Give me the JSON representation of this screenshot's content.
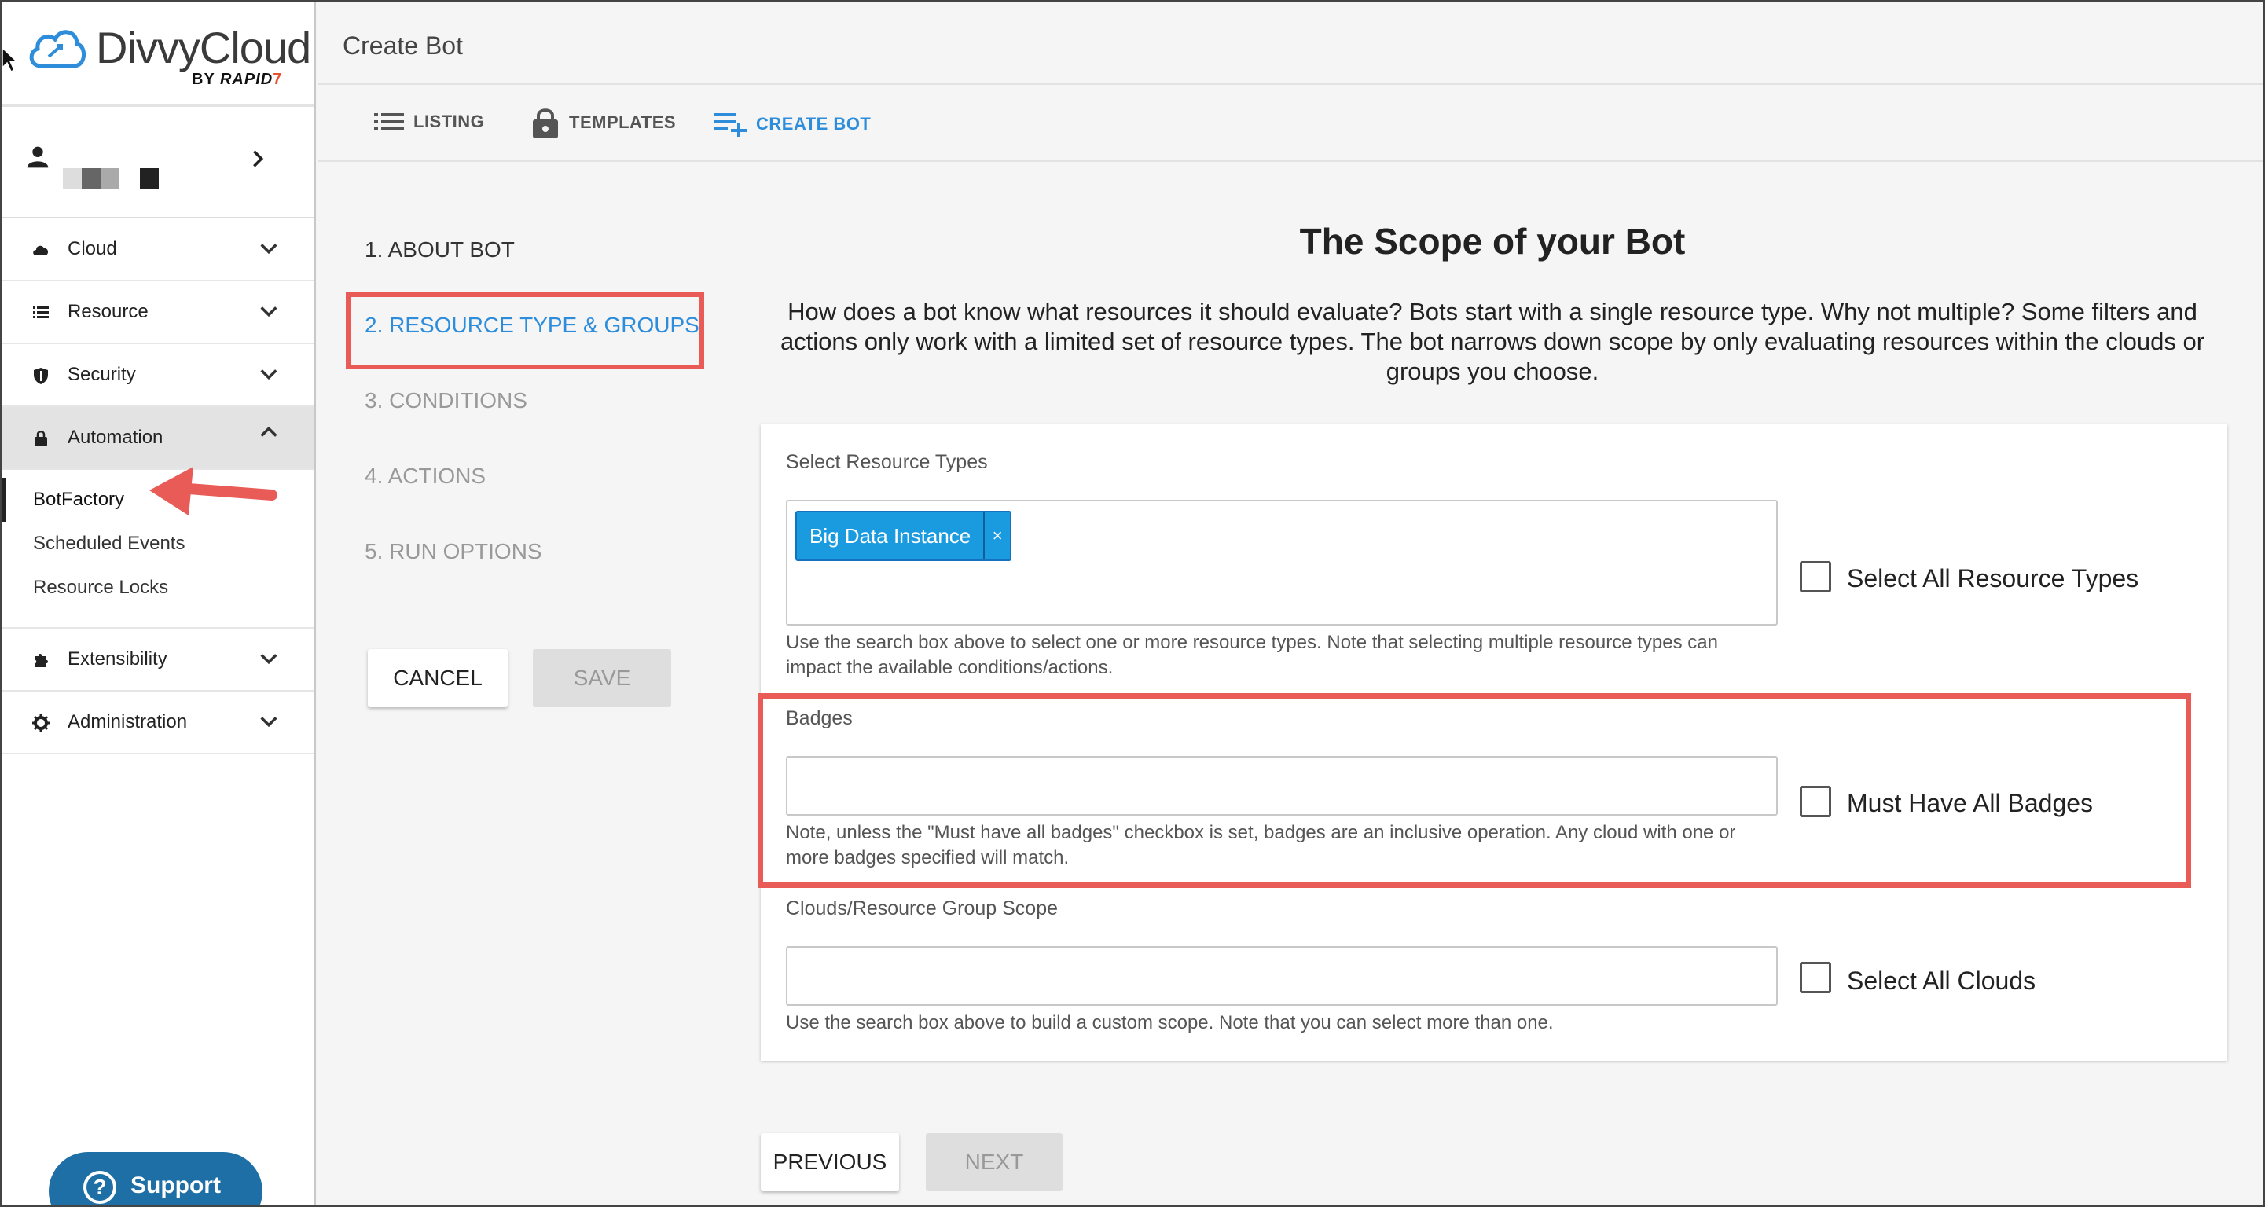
{
  "app": {
    "brand": "DivvyCloud",
    "brand_by": "BY",
    "brand_rapid": "RAPID",
    "brand_seven": "7",
    "accent_color": "#2d8ddb",
    "highlight_color": "#e85b57"
  },
  "sidebar": {
    "nav": [
      {
        "label": "Cloud",
        "icon": "cloud-icon"
      },
      {
        "label": "Resource",
        "icon": "list-icon"
      },
      {
        "label": "Security",
        "icon": "shield-icon"
      },
      {
        "label": "Automation",
        "icon": "lock-icon",
        "expanded": true
      },
      {
        "label": "Extensibility",
        "icon": "puzzle-icon"
      },
      {
        "label": "Administration",
        "icon": "gear-icon"
      }
    ],
    "automation_sub": [
      {
        "label": "BotFactory",
        "active": true
      },
      {
        "label": "Scheduled Events"
      },
      {
        "label": "Resource Locks"
      }
    ],
    "support_label": "Support"
  },
  "header": {
    "title": "Create Bot"
  },
  "tabs": [
    {
      "label": "LISTING",
      "icon": "list-icon"
    },
    {
      "label": "TEMPLATES",
      "icon": "lock-icon"
    },
    {
      "label": "CREATE BOT",
      "icon": "playlist-add-icon",
      "active": true
    }
  ],
  "steps": [
    {
      "label": "1. ABOUT BOT",
      "state": "done"
    },
    {
      "label": "2. RESOURCE TYPE & GROUPS",
      "state": "current"
    },
    {
      "label": "3. CONDITIONS",
      "state": "pending"
    },
    {
      "label": "4. ACTIONS",
      "state": "pending"
    },
    {
      "label": "5. RUN OPTIONS",
      "state": "pending"
    }
  ],
  "actions": {
    "cancel": "CANCEL",
    "save": "SAVE",
    "previous": "PREVIOUS",
    "next": "NEXT"
  },
  "main": {
    "title": "The Scope of your Bot",
    "description": "How does a bot know what resources it should evaluate? Bots start with a single resource type. Why not multiple? Some filters and actions only work with a limited set of resource types. The bot narrows down scope by only evaluating resources within the clouds or groups you choose.",
    "resource_types": {
      "label": "Select Resource Types",
      "selected": [
        "Big Data Instance"
      ],
      "chip_remove": "×",
      "help": "Use the search box above to select one or more resource types. Note that selecting multiple resource types can impact the available conditions/actions.",
      "select_all_label": "Select All Resource Types",
      "select_all_checked": false
    },
    "badges": {
      "label": "Badges",
      "value": "",
      "help": "Note, unless the \"Must have all badges\" checkbox is set, badges are an inclusive operation. Any cloud with one or more badges specified will match.",
      "must_have_all_label": "Must Have All Badges",
      "must_have_all_checked": false
    },
    "clouds": {
      "label": "Clouds/Resource Group Scope",
      "value": "",
      "help": "Use the search box above to build a custom scope. Note that you can select more than one.",
      "select_all_label": "Select All Clouds",
      "select_all_checked": false
    }
  }
}
